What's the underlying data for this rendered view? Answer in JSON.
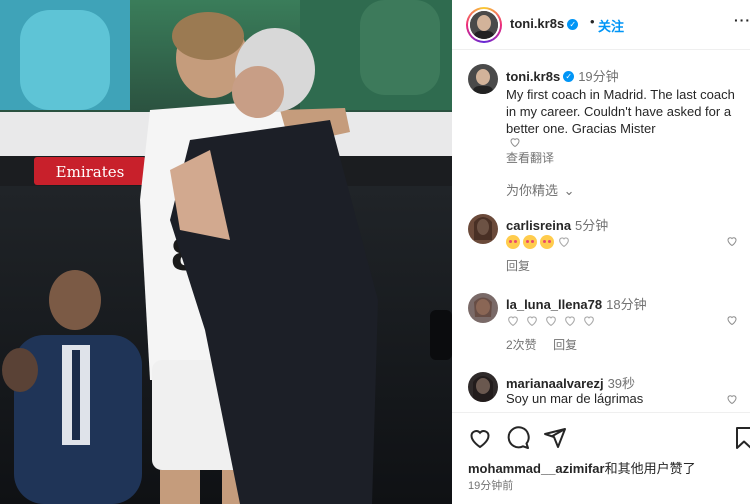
{
  "post": {
    "username": "toni.kr8s",
    "follow_label": "关注",
    "dot": "•",
    "more_label": "···"
  },
  "caption": {
    "username": "toni.kr8s",
    "time": "19分钟",
    "text": "My first coach in Madrid. The last coach in my career. Couldn't have asked for a better one. Gracias Mister",
    "see_translation": "查看翻译"
  },
  "for_you": {
    "label": "为你精选",
    "chevron": "⌄"
  },
  "comments": [
    {
      "username": "carlisreina",
      "time": "5分钟",
      "text": "",
      "reply": "回复",
      "replies_count": "",
      "avatar_color": "#6b4a3a"
    },
    {
      "username": "la_luna_llena78",
      "time": "18分钟",
      "text": "",
      "reply": "回复",
      "replies_count": "2次赞",
      "avatar_color": "#8a6a58"
    },
    {
      "username": "marianaalvarezj",
      "time": "39秒",
      "text": "Soy un mar de lágrimas",
      "reply": "",
      "replies_count": "",
      "avatar_color": "#2f2a2a"
    }
  ],
  "likes": {
    "user": "mohammad__azimifar",
    "suffix": "和其他用户赞了"
  },
  "post_time": "19分钟前",
  "photo": {
    "banner_text": "Emirates"
  }
}
